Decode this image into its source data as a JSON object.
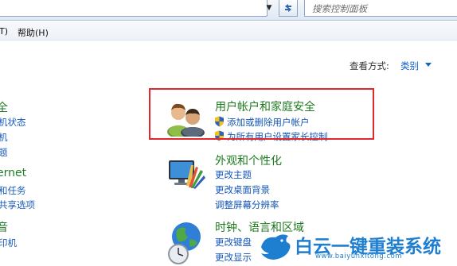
{
  "search": {
    "placeholder": "搜索控制面板"
  },
  "menu": {
    "cut_item": "T)",
    "help": "帮助(H)"
  },
  "view_by": {
    "label": "查看方式:",
    "value": "类别"
  },
  "left_column": [
    {
      "text": "全",
      "kind": "head"
    },
    {
      "text": "机状态",
      "kind": "link"
    },
    {
      "text": "机",
      "kind": "link"
    },
    {
      "text": "题",
      "kind": "link"
    },
    {
      "text": "ernet",
      "kind": "head"
    },
    {
      "text": "和任务",
      "kind": "link"
    },
    {
      "text": "共享选项",
      "kind": "link"
    },
    {
      "text": "音",
      "kind": "head"
    },
    {
      "text": "印机",
      "kind": "link"
    },
    {
      "text": "",
      "kind": "link"
    }
  ],
  "categories": [
    {
      "title": "用户帐户和家庭安全",
      "links": [
        "添加或删除用户帐户",
        "为所有用户设置家长控制"
      ],
      "icon": "users-icon",
      "highlighted": true
    },
    {
      "title": "外观和个性化",
      "links": [
        "更改主题",
        "更改桌面背景",
        "调整屏幕分辨率"
      ],
      "icon": "appearance-icon"
    },
    {
      "title": "时钟、语言和区域",
      "links": [
        "更改键盘",
        "更改显示"
      ],
      "icon": "clock-globe-icon"
    }
  ],
  "watermark": {
    "title": "白云一键重装系统",
    "url": "www.baiyunxitong.com"
  },
  "colors": {
    "link_blue": "#1557b7",
    "category_green": "#1e7a1e",
    "highlight_red": "#e0272e",
    "watermark_blue": "#1e7fd0"
  }
}
